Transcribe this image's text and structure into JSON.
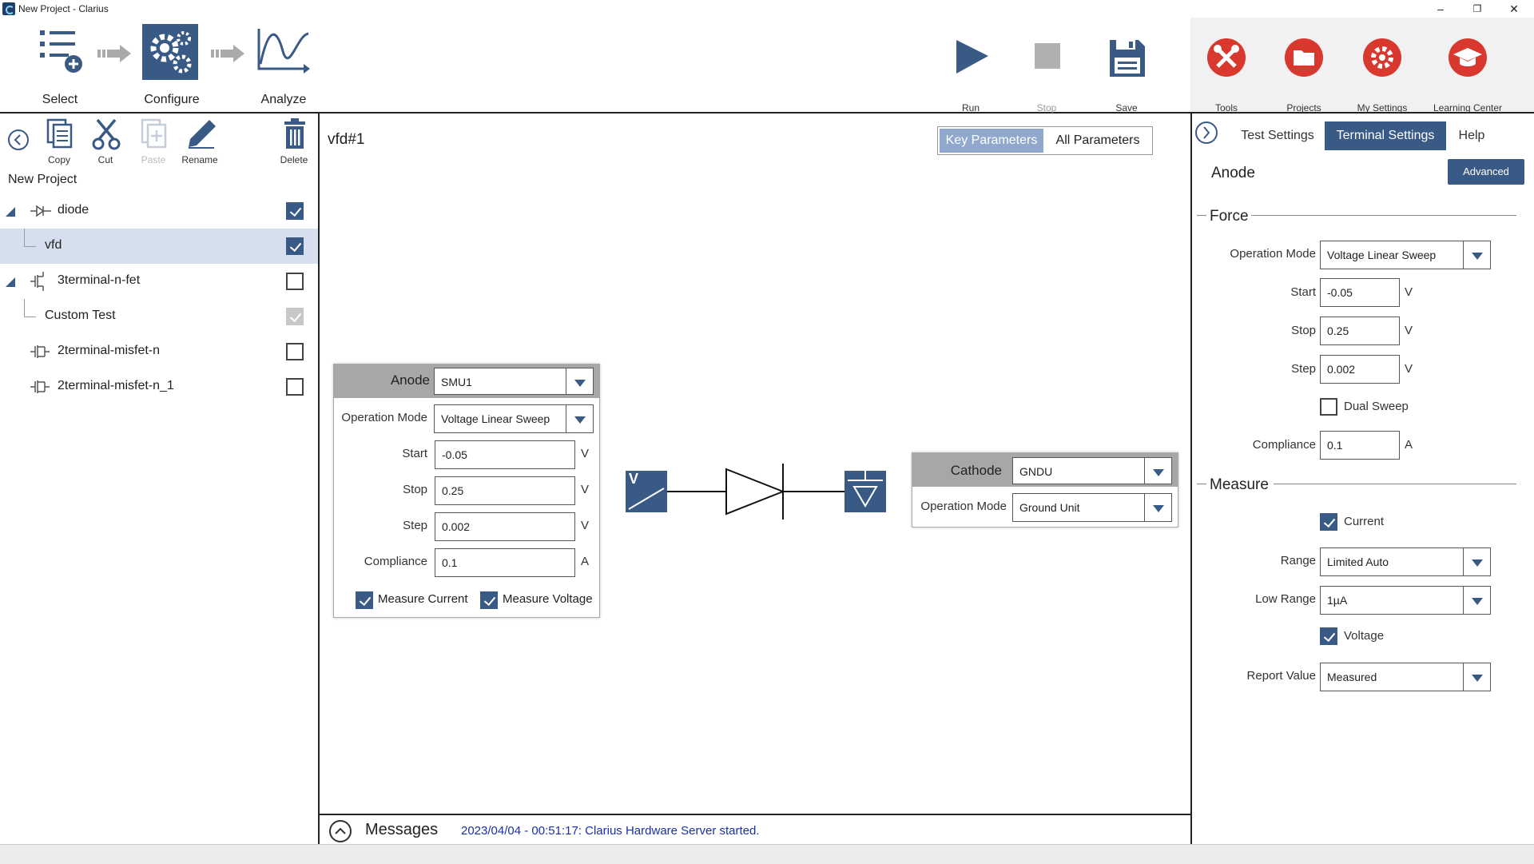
{
  "window": {
    "title": "New Project - Clarius",
    "minimize": "–",
    "restore": "❐",
    "close": "✕"
  },
  "workflow": {
    "select": "Select",
    "configure": "Configure",
    "analyze": "Analyze"
  },
  "toolbar": {
    "run": "Run",
    "stop": "Stop",
    "save": "Save",
    "tools": "Tools",
    "projects": "Projects",
    "my_settings": "My Settings",
    "learning_center": "Learning Center"
  },
  "left": {
    "tools": {
      "copy": "Copy",
      "cut": "Cut",
      "paste": "Paste",
      "rename": "Rename",
      "delete": "Delete"
    },
    "project_name": "New Project",
    "tree": [
      {
        "label": "diode",
        "checked": true
      },
      {
        "label": "vfd",
        "checked": true
      },
      {
        "label": "3terminal-n-fet",
        "checked": false
      },
      {
        "label": "Custom Test",
        "checked": true
      },
      {
        "label": "2terminal-misfet-n",
        "checked": false
      },
      {
        "label": "2terminal-misfet-n_1",
        "checked": false
      }
    ]
  },
  "center": {
    "test_name": "vfd#1",
    "toggle": {
      "key": "Key Parameters",
      "all": "All Parameters"
    },
    "anode": {
      "label": "Anode",
      "instrument": "SMU1",
      "operation_mode_label": "Operation Mode",
      "operation_mode": "Voltage Linear Sweep",
      "start_label": "Start",
      "start": "-0.05",
      "stop_label": "Stop",
      "stop": "0.25",
      "step_label": "Step",
      "step": "0.002",
      "compliance_label": "Compliance",
      "compliance": "0.1",
      "volt_unit": "V",
      "amp_unit": "A",
      "measure_current": "Measure Current",
      "measure_voltage": "Measure Voltage"
    },
    "source_symbol": "V",
    "cathode": {
      "label": "Cathode",
      "instrument": "GNDU",
      "operation_mode_label": "Operation Mode",
      "operation_mode": "Ground Unit"
    }
  },
  "right": {
    "tabs": {
      "test_settings": "Test Settings",
      "terminal_settings": "Terminal Settings",
      "help": "Help"
    },
    "terminal": "Anode",
    "advanced": "Advanced",
    "force": {
      "title": "Force",
      "operation_mode_label": "Operation Mode",
      "operation_mode": "Voltage Linear Sweep",
      "start_label": "Start",
      "start": "-0.05",
      "stop_label": "Stop",
      "stop": "0.25",
      "step_label": "Step",
      "step": "0.002",
      "dual_sweep": "Dual Sweep",
      "compliance_label": "Compliance",
      "compliance": "0.1",
      "volt_unit": "V",
      "amp_unit": "A"
    },
    "measure": {
      "title": "Measure",
      "current": "Current",
      "range_label": "Range",
      "range": "Limited Auto",
      "low_range_label": "Low Range",
      "low_range": "1µA",
      "voltage": "Voltage",
      "report_value_label": "Report Value",
      "report_value": "Measured"
    }
  },
  "messages": {
    "title": "Messages",
    "text": "2023/04/04 - 00:51:17: Clarius Hardware Server started."
  },
  "colors": {
    "accent": "#3a5a86",
    "tool_red": "#d9382e",
    "message_blue": "#1a2fa8"
  }
}
